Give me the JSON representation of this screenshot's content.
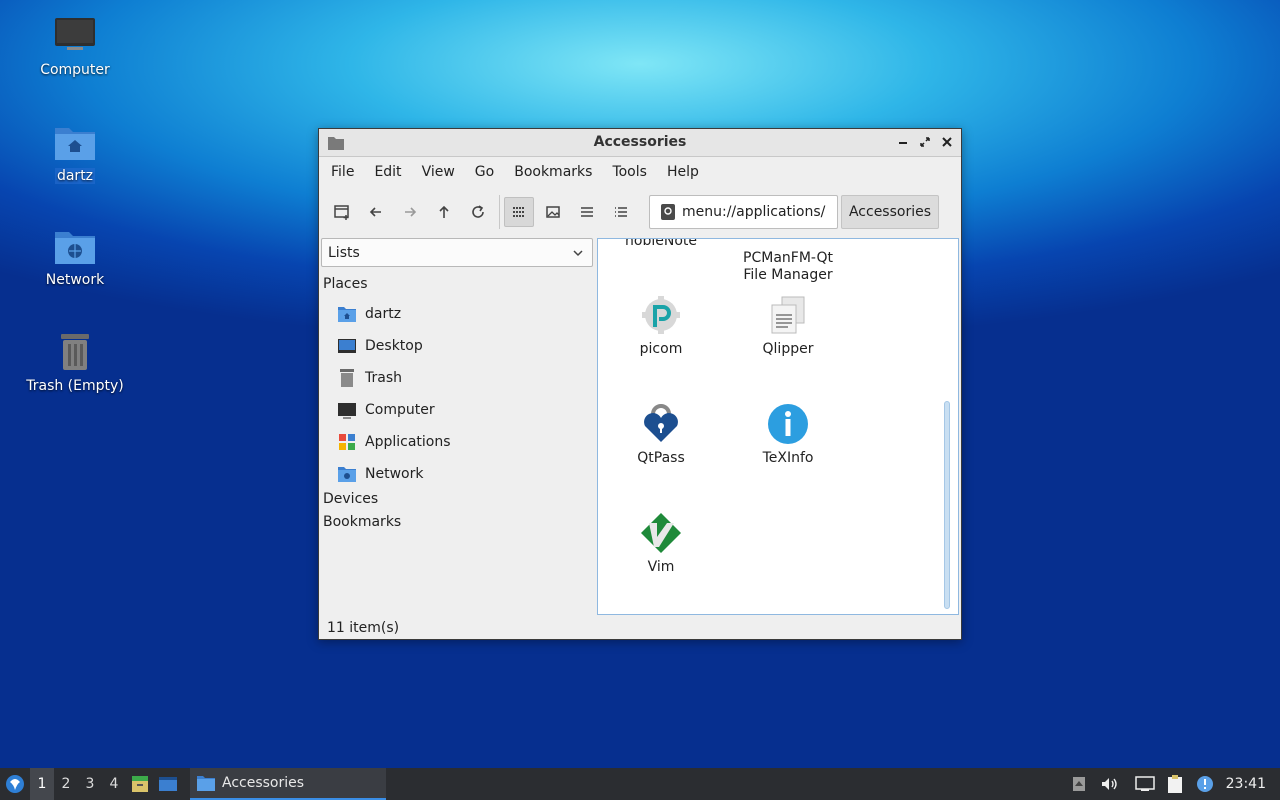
{
  "desktop": {
    "icons": [
      {
        "label": "Computer"
      },
      {
        "label": "dartz"
      },
      {
        "label": "Network"
      },
      {
        "label": "Trash (Empty)"
      }
    ]
  },
  "window": {
    "title": "Accessories",
    "menu": [
      "File",
      "Edit",
      "View",
      "Go",
      "Bookmarks",
      "Tools",
      "Help"
    ],
    "address": "menu://applications/",
    "breadcrumb": "Accessories",
    "sidebar": {
      "selector_value": "Lists",
      "places_label": "Places",
      "places": [
        "dartz",
        "Desktop",
        "Trash",
        "Computer",
        "Applications",
        "Network"
      ],
      "devices_label": "Devices",
      "bookmarks_label": "Bookmarks"
    },
    "files": [
      {
        "name": "nobleNote"
      },
      {
        "name": "PCManFM-Qt\nFile Manager"
      },
      {
        "name": "picom"
      },
      {
        "name": "Qlipper"
      },
      {
        "name": "QtPass"
      },
      {
        "name": "TeXInfo"
      },
      {
        "name": "Vim"
      }
    ],
    "status": "11 item(s)"
  },
  "taskbar": {
    "workspaces": [
      "1",
      "2",
      "3",
      "4"
    ],
    "task_label": "Accessories",
    "clock": "23:41"
  },
  "colors": {
    "accent": "#3a8ee6",
    "folder_blue": "#4a8fd8",
    "taskbar": "#2b2d31"
  }
}
